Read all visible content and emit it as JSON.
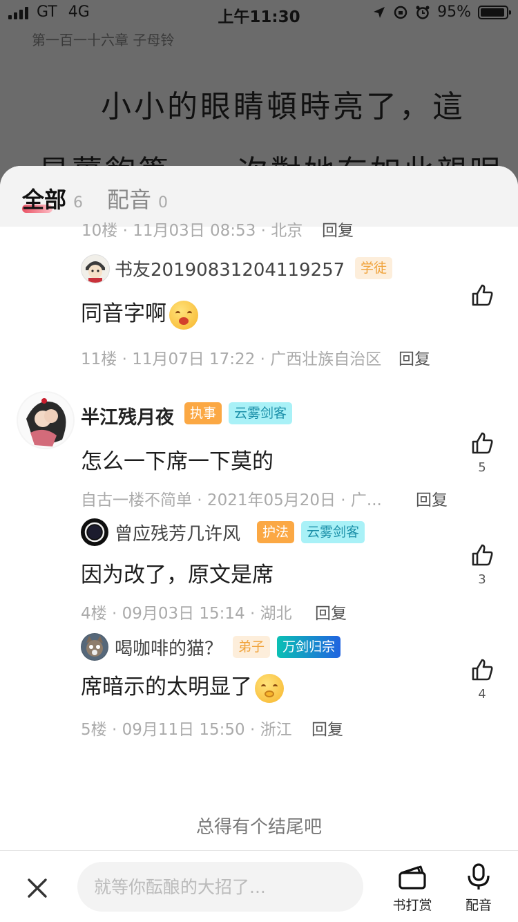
{
  "status_bar": {
    "carrier": "GT",
    "network": "4G",
    "time": "上午11:30",
    "battery": "95%",
    "battery_level": 0.95
  },
  "reader": {
    "chapter_title": "第一百一十六章 子母铃",
    "line1": "小小的眼睛頓時亮了，這",
    "line2": "是薑飽筆，一次對她有如此親昵"
  },
  "tabs": [
    {
      "label": "全部",
      "count": "6"
    },
    {
      "label": "配音",
      "count": "0"
    }
  ],
  "comments": {
    "partial_meta": "10楼 · 11月03日 08:53 · 北京",
    "partial_reply": "回复",
    "reply1": {
      "nickname": "书友20190831204119257",
      "badge": "学徒",
      "content": "同音字啊",
      "meta": "11楼 · 11月07日 17:22 · 广西壮族自治区",
      "reply": "回复"
    },
    "main": {
      "nickname": "半江残月夜",
      "badges": [
        "执事",
        "云雾剑客"
      ],
      "content": "怎么一下席一下莫的",
      "meta": "自古一楼不简单 · 2021年05月20日 · 广...",
      "reply": "回复",
      "likes": "5"
    },
    "reply2": {
      "nickname": "曾应残芳几许风",
      "badges": [
        "护法",
        "云雾剑客"
      ],
      "content": "因为改了，原文是席",
      "meta": "4楼 · 09月03日 15:14 · 湖北",
      "reply": "回复",
      "likes": "3"
    },
    "reply3": {
      "nickname": "喝咖啡的猫？",
      "badges": [
        "弟子",
        "万剑归宗"
      ],
      "content": "席暗示的太明显了",
      "meta": "5楼 · 09月11日 15:50 · 浙江",
      "reply": "回复",
      "likes": "4"
    }
  },
  "footer_note": "总得有个结尾吧",
  "bottom_bar": {
    "input_placeholder": "就等你酝酿的大招了...",
    "tip_label": "书打赏",
    "voice_label": "配音"
  }
}
